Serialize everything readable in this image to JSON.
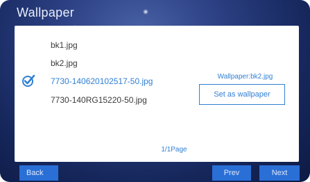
{
  "window": {
    "title": "Wallpaper"
  },
  "files": [
    {
      "name": "bk1.jpg",
      "selected": false
    },
    {
      "name": "bk2.jpg",
      "selected": false
    },
    {
      "name": "7730-140620102517-50.jpg",
      "selected": true
    },
    {
      "name": "7730-140RG15220-50.jpg",
      "selected": false
    }
  ],
  "current_wallpaper_label": "Wallpaper:bk2.jpg",
  "set_wallpaper_label": "Set as wallpaper",
  "page_indicator": "1/1Page",
  "nav": {
    "back_label": "Back",
    "prev_label": "Prev",
    "next_label": "Next"
  },
  "icons": {
    "selected_marker": "checkmark-circle-icon"
  },
  "colors": {
    "accent": "#2f7fd4",
    "button_bg": "#2a6fd6",
    "text_default": "#3a3a3a",
    "panel_bg": "#ffffff"
  }
}
